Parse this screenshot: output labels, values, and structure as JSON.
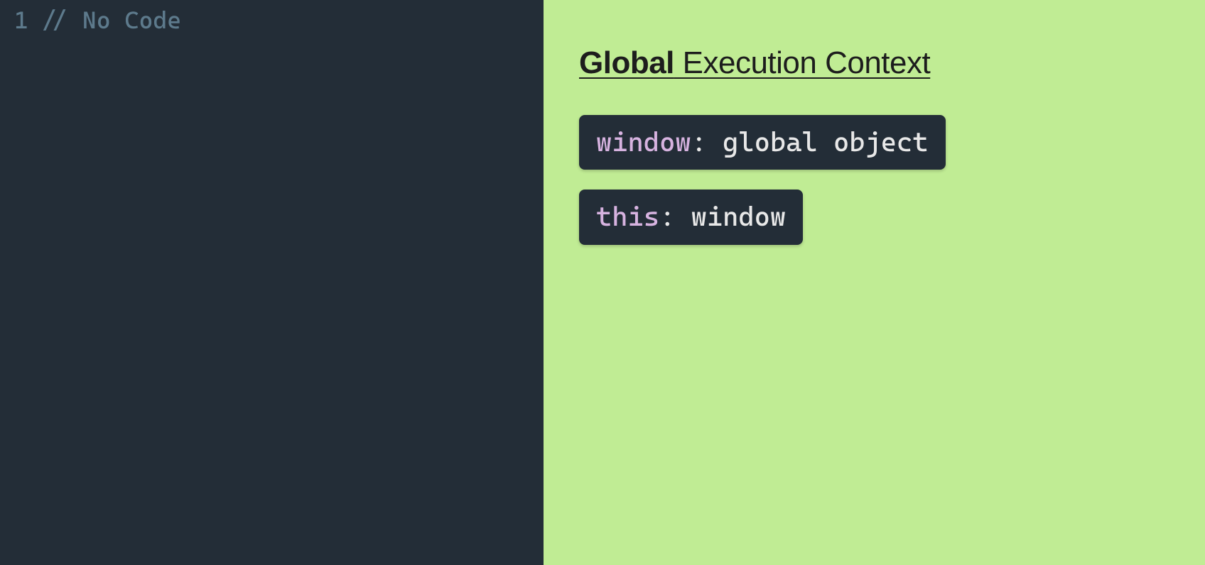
{
  "editor": {
    "lines": [
      {
        "number": "1",
        "content": "// No Code"
      }
    ]
  },
  "context": {
    "title_bold": "Global",
    "title_rest": " Execution Context",
    "bindings": [
      {
        "key": "window",
        "value": "global object"
      },
      {
        "key": "this",
        "value": "window"
      }
    ]
  }
}
